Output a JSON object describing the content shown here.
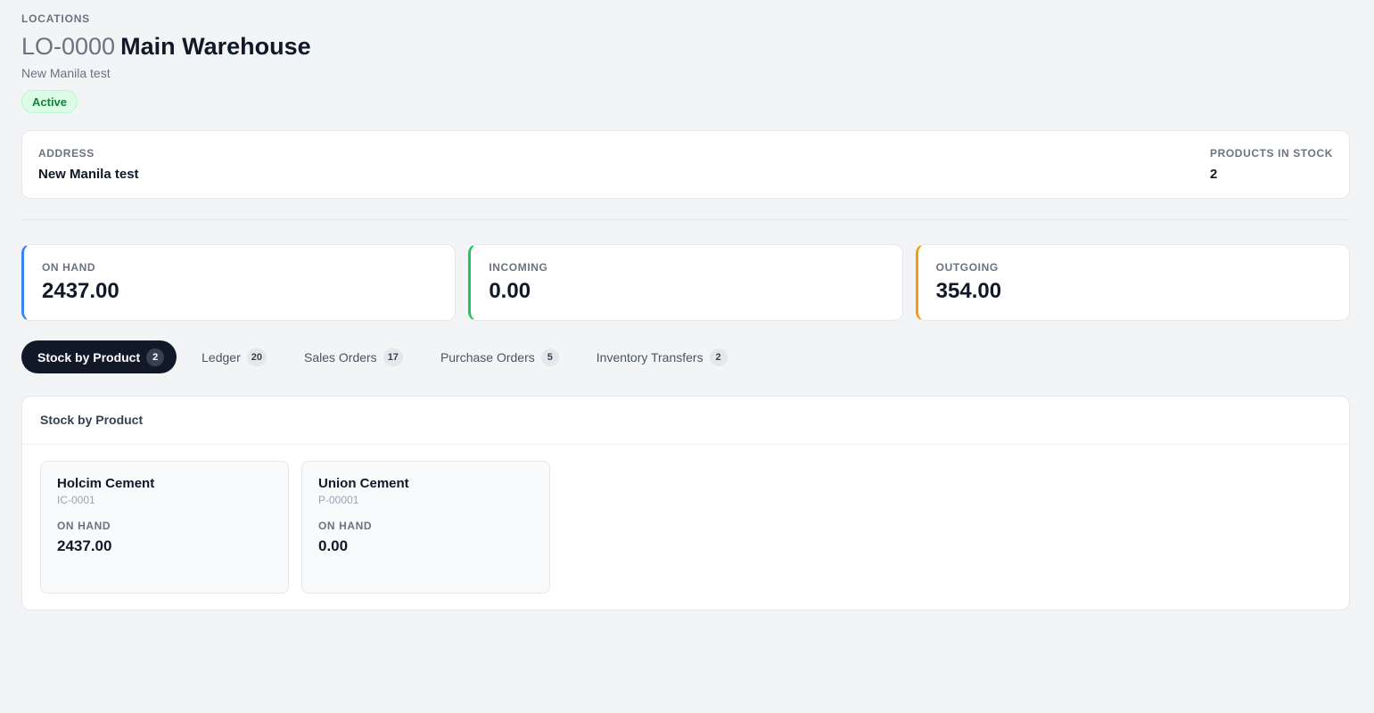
{
  "header": {
    "breadcrumb": "LOCATIONS",
    "code": "LO-0000",
    "name": "Main Warehouse",
    "subtitle": "New Manila test",
    "status": "Active"
  },
  "info": {
    "address_label": "ADDRESS",
    "address_value": "New Manila test",
    "products_label": "PRODUCTS IN STOCK",
    "products_value": "2"
  },
  "stats": [
    {
      "label": "ON HAND",
      "value": "2437.00",
      "color": "#3b82f6"
    },
    {
      "label": "INCOMING",
      "value": "0.00",
      "color": "#22c55e"
    },
    {
      "label": "OUTGOING",
      "value": "354.00",
      "color": "#f59e0b"
    }
  ],
  "tabs": [
    {
      "label": "Stock by Product",
      "count": "2",
      "active": true
    },
    {
      "label": "Ledger",
      "count": "20",
      "active": false
    },
    {
      "label": "Sales Orders",
      "count": "17",
      "active": false
    },
    {
      "label": "Purchase Orders",
      "count": "5",
      "active": false
    },
    {
      "label": "Inventory Transfers",
      "count": "2",
      "active": false
    }
  ],
  "panel": {
    "title": "Stock by Product",
    "products": [
      {
        "name": "Holcim Cement",
        "sku": "IC-0001",
        "label": "ON HAND",
        "value": "2437.00"
      },
      {
        "name": "Union Cement",
        "sku": "P-00001",
        "label": "ON HAND",
        "value": "0.00"
      }
    ]
  }
}
